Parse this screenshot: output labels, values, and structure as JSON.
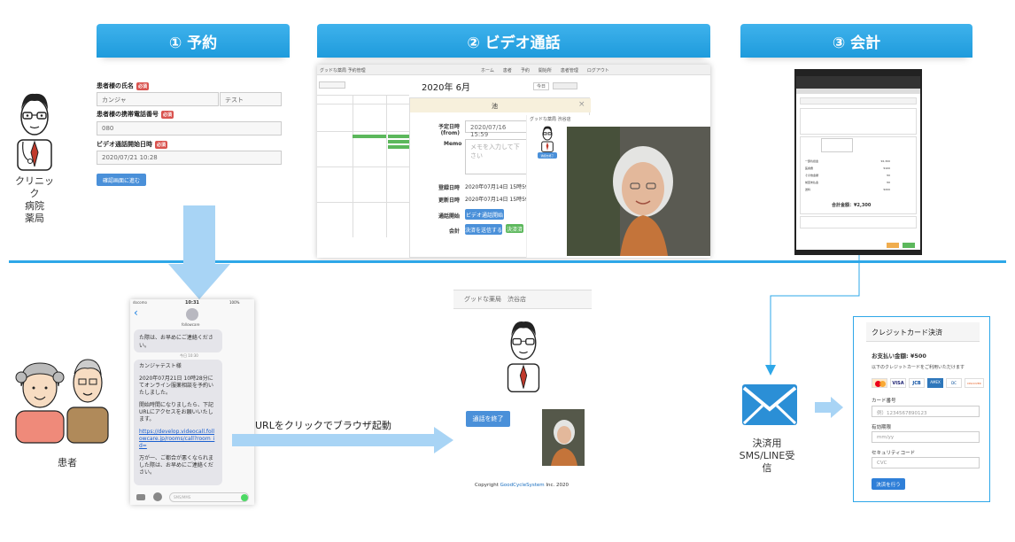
{
  "steps": [
    {
      "label": "① 予約"
    },
    {
      "label": "② ビデオ通話"
    },
    {
      "label": "③ 会計"
    }
  ],
  "clinic_caption": "クリニック\n病院\n薬局",
  "patient_caption": "患者",
  "reservation_form": {
    "name_label": "患者様の氏名",
    "required": "必須",
    "name_value_1": "カンジャ",
    "name_value_2": "テスト",
    "phone_label": "患者様の携帯電話番号",
    "phone_value": "080",
    "start_label": "ビデオ通話開始日時",
    "start_value": "2020/07/21 10:28",
    "confirm_button": "確認画面に進む"
  },
  "video_calendar": {
    "app_title": "グッドな薬局 予約管理",
    "nav": [
      "ホーム",
      "患者",
      "予約",
      "開始所",
      "患者管理",
      "ログアウト"
    ],
    "month": "2020年 6月",
    "today": "今日",
    "modal_title": "池",
    "scheduled_label": "予定日時\n(from)",
    "scheduled_value": "2020/07/16 15:59",
    "memo_label": "Memo",
    "memo_placeholder": "メモを入力して下さい",
    "registered_label": "登録日時",
    "registered_value": "2020年07月14日 15時59分",
    "updated_label": "更新日時",
    "updated_value": "2020年07月14日 15時59分",
    "call_start_label": "通話開始",
    "call_start_button": "ビデオ通話開始",
    "accounting_label": "会計",
    "settle_button": "決済を送信する",
    "settled_badge": "決済済",
    "inner_header": "グッドな薬局 渋谷店",
    "end_small": "通話を終了"
  },
  "accounting_panel": {
    "total_label": "合計金額：",
    "total_value": "¥2,300",
    "rows": [
      {
        "label": "一部負担金",
        "value": "¥2,300"
      },
      {
        "label": "医療費",
        "value": "¥100"
      },
      {
        "label": "その他金額",
        "value": "¥0"
      },
      {
        "label": "前回未払金",
        "value": "¥0"
      },
      {
        "label": "送料",
        "value": "¥200"
      }
    ]
  },
  "sms": {
    "carrier": "docomo",
    "time": "10:31",
    "battery": "100%",
    "contact": "followcare",
    "prev_text": "た際は、お早めにご連絡ください。",
    "timestamp": "今日 10:30",
    "greeting": "カンジャテスト様",
    "body1": "2020年07月21日 10時28分にてオンライン服薬相談を予約いたしました。",
    "body2": "開始時間になりましたら、下記URLにアクセスをお願いいたします。",
    "link": "https://develop.videocall.followcare.jp/rooms/call?room_id=",
    "body3": "万が一、ご都合が悪くなられました際は、お早めにご連絡ください。",
    "input_placeholder": "SMS/MMS"
  },
  "arrow_text": "URLをクリックでブラウザ起動",
  "patient_video": {
    "store": "グッドな薬局　渋谷店",
    "end_button": "通話を終了",
    "copyright_prefix": "Copyright ",
    "copyright_brand": "GoodCycleSystem",
    "copyright_suffix": " Inc. 2020"
  },
  "mail_caption": "決済用\nSMS/LINE受\n信",
  "card_payment": {
    "title": "クレジットカード決済",
    "amount": "お支払い金額: ¥500",
    "note": "以下のクレジットカードをご利用いただけます",
    "card_number_label": "カード番号",
    "card_number_placeholder": "例）1234567890123",
    "expiry_label": "有効期限",
    "expiry_placeholder": "mm/yy",
    "cvc_label": "セキュリティコード",
    "cvc_placeholder": "CVC",
    "pay_button": "決済を行う",
    "brands": [
      "VISA",
      "JCB",
      "AMEX",
      "DC",
      "DISCOVER"
    ]
  },
  "colors": {
    "banner": "#1e9bdc",
    "divider": "#2ea7e8",
    "arrow": "#a8d4f5",
    "button_blue": "#4a90d9",
    "required_red": "#d9534f",
    "mail_blue": "#2b8fd6"
  }
}
